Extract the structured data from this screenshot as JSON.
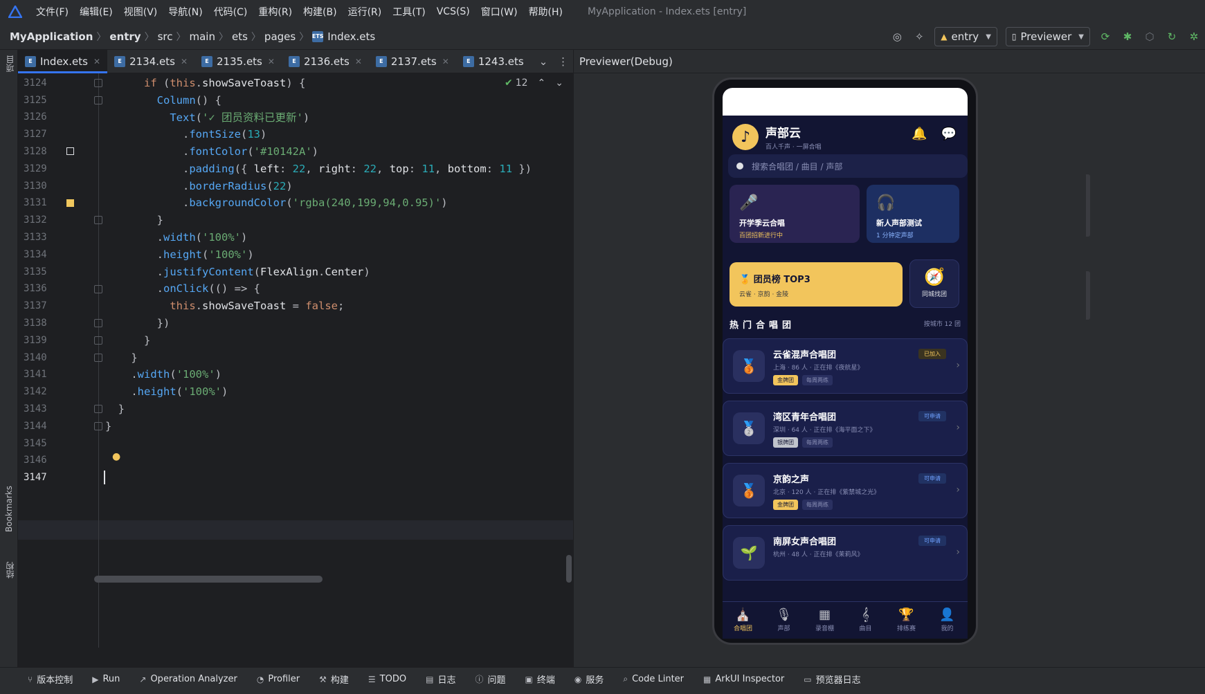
{
  "menubar": {
    "items": [
      "文件(F)",
      "编辑(E)",
      "视图(V)",
      "导航(N)",
      "代码(C)",
      "重构(R)",
      "构建(B)",
      "运行(R)",
      "工具(T)",
      "VCS(S)",
      "窗口(W)",
      "帮助(H)"
    ],
    "window_title": "MyApplication - Index.ets [entry]"
  },
  "breadcrumb": [
    "MyApplication",
    "entry",
    "src",
    "main",
    "ets",
    "pages",
    "Index.ets"
  ],
  "toolbar": {
    "module": "entry",
    "device": "Previewer"
  },
  "left_strip": {
    "project": "项目",
    "bookmarks": "Bookmarks",
    "structure": "结构"
  },
  "tabs": [
    {
      "label": "Index.ets",
      "active": true
    },
    {
      "label": "2134.ets"
    },
    {
      "label": "2135.ets"
    },
    {
      "label": "2136.ets"
    },
    {
      "label": "2137.ets"
    },
    {
      "label": "1243.ets"
    }
  ],
  "editor": {
    "inspection_count": "12",
    "lines": [
      {
        "n": "3124"
      },
      {
        "n": "3125"
      },
      {
        "n": "3126"
      },
      {
        "n": "3127"
      },
      {
        "n": "3128"
      },
      {
        "n": "3129"
      },
      {
        "n": "3130"
      },
      {
        "n": "3131"
      },
      {
        "n": "3132"
      },
      {
        "n": "3133"
      },
      {
        "n": "3134"
      },
      {
        "n": "3135"
      },
      {
        "n": "3136"
      },
      {
        "n": "3137"
      },
      {
        "n": "3138"
      },
      {
        "n": "3139"
      },
      {
        "n": "3140"
      },
      {
        "n": "3141"
      },
      {
        "n": "3142"
      },
      {
        "n": "3143"
      },
      {
        "n": "3144"
      },
      {
        "n": "3145"
      },
      {
        "n": "3146"
      },
      {
        "n": "3147"
      }
    ]
  },
  "preview": {
    "title": "Previewer(Debug)",
    "app_name": "声部云",
    "app_sub": "百人千声 · 一屏合唱",
    "search_placeholder": "搜索合唱团 / 曲目 / 声部",
    "card1_title": "开学季云合唱",
    "card1_sub": "百团招新进行中",
    "card2_title": "新人声部测试",
    "card2_sub": "1 分钟定声部",
    "top3_title": "团员榜 TOP3",
    "top3_sub": "云雀 · 京韵 · 金陵",
    "city_label": "同城找团",
    "section_title": "热门合唱团",
    "section_right": "按城市 12 团",
    "choirs": [
      {
        "name": "云雀混声合唱团",
        "meta": "上海 · 86 人 · 正在排《夜航星》",
        "tag1": "金牌团",
        "tag2": "每周两练",
        "badge": "已加入"
      },
      {
        "name": "湾区青年合唱团",
        "meta": "深圳 · 64 人 · 正在排《海平面之下》",
        "tag1": "银牌团",
        "tag2": "每周两练",
        "badge": "可申请"
      },
      {
        "name": "京韵之声",
        "meta": "北京 · 120 人 · 正在排《紫禁城之光》",
        "tag1": "金牌团",
        "tag2": "每周两练",
        "badge": "可申请"
      },
      {
        "name": "南屏女声合唱团",
        "meta": "杭州 · 48 人 · 正在排《茉莉风》",
        "tag1": "",
        "tag2": "",
        "badge": "可申请"
      }
    ],
    "nav": [
      "合唱团",
      "声部",
      "录音棚",
      "曲目",
      "排练赛",
      "我的"
    ]
  },
  "bottombar": [
    "版本控制",
    "Run",
    "Operation Analyzer",
    "Profiler",
    "构建",
    "TODO",
    "日志",
    "问题",
    "终端",
    "服务",
    "Code Linter",
    "ArkUI Inspector",
    "预览器日志"
  ],
  "colors": {
    "accent": "#3574f0",
    "gold": "#f2c55c",
    "app_bg": "#121533"
  }
}
